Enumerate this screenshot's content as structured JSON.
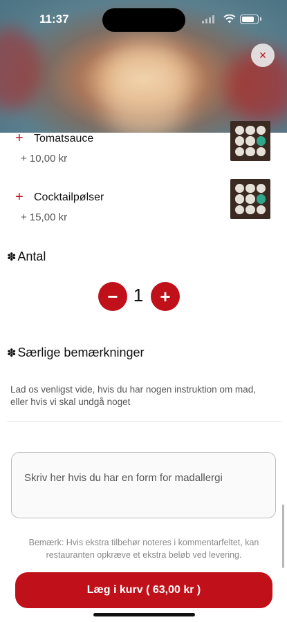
{
  "status_bar": {
    "time": "11:37"
  },
  "close_label": "×",
  "items": [
    {
      "plus": "+",
      "name": "Tomatsauce",
      "price": "+ 10,00 kr"
    },
    {
      "plus": "+",
      "name": "Cocktailpølser",
      "price": "+ 15,00 kr"
    }
  ],
  "quantity": {
    "title": "Antal",
    "minus": "−",
    "value": "1",
    "plus": "+"
  },
  "remarks": {
    "title": "Særlige bemærkninger",
    "description": "Lad os venligst vide, hvis du har nogen instruktion om mad, eller hvis vi skal undgå noget",
    "placeholder": "Skriv her hvis du har en form for madallergi"
  },
  "disclaimer": "Bemærk: Hvis ekstra tilbehør noteres i kommentarfeltet, kan restauranten opkræve et ekstra beløb ved levering.",
  "cart_button": "Læg i kurv ( 63,00 kr )",
  "colors": {
    "accent": "#c0111a"
  },
  "icons": {
    "section": "puzzle-icon",
    "close": "close-icon"
  }
}
